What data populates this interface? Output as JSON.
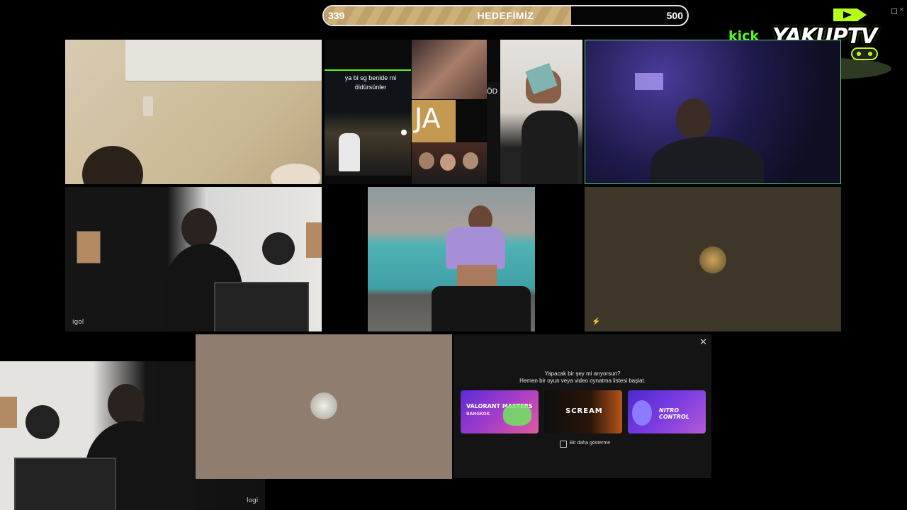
{
  "goal": {
    "current": "339",
    "title": "HEDEFİMİZ",
    "target": "500",
    "progress": 0.68
  },
  "branding": {
    "platform": "kick",
    "channel": "YAKUPTV",
    "accent": "#53fc18"
  },
  "cams": {
    "cam_igol": "igol",
    "cam_logi": "logi"
  },
  "tiktok": {
    "caption": "ya bi sg benide mi öldürsünler",
    "ja_text": "JA",
    "od_text": "ÖD"
  },
  "dialog": {
    "title": "Yapacak bir şey mi arıyorsun?",
    "subtitle": "Hemen bir oyun veya video oynatma listesi başlat.",
    "close": "✕",
    "cards": [
      {
        "label": "VALORANT MASTERS",
        "sub": "BANGKOK"
      },
      {
        "label": "SCREAM",
        "sub": ""
      },
      {
        "label": "NITRO CONTROL",
        "sub": ""
      }
    ],
    "dont_show": "Bir daha gösterme"
  },
  "colors": {
    "active_border": "#5fd07a",
    "beige_tile": "#8f7d70",
    "olive_tile": "#3e3729"
  }
}
